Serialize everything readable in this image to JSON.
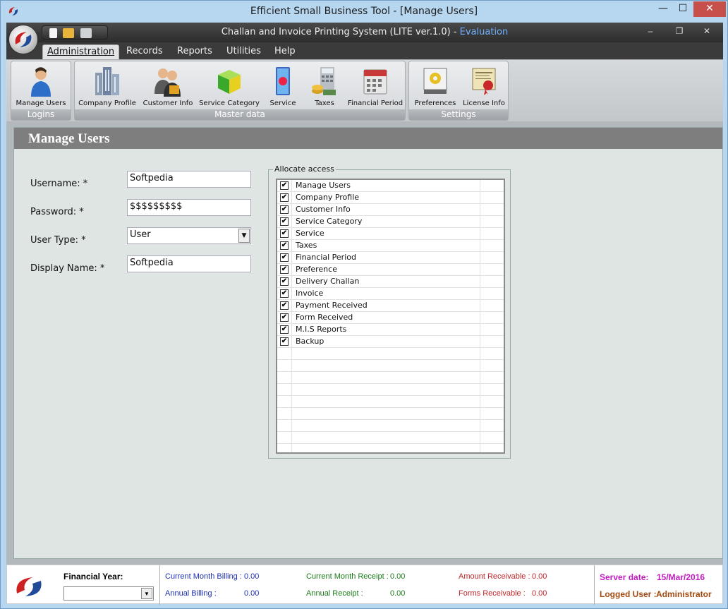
{
  "window": {
    "title": "Efficient Small Business Tool - [Manage Users]",
    "min": "—",
    "max": "☐",
    "close": "✕"
  },
  "app": {
    "title": "Challan and Invoice Printing System (LITE ver.1.0) - ",
    "edition": "Evaluation",
    "min": "–",
    "restore": "❐",
    "close": "✕"
  },
  "menu": [
    "Administration",
    "Records",
    "Reports",
    "Utilities",
    "Help"
  ],
  "ribbon": {
    "groups": [
      {
        "label": "Logins",
        "buttons": [
          "Manage Users"
        ]
      },
      {
        "label": "Master data",
        "buttons": [
          "Company Profile",
          "Customer Info",
          "Service Category",
          "Service",
          "Taxes",
          "Financial Period"
        ]
      },
      {
        "label": "Settings",
        "buttons": [
          "Preferences",
          "License Info"
        ]
      }
    ]
  },
  "form": {
    "title": "Manage Users",
    "username_label": "Username: *",
    "username_value": "Softpedia",
    "password_label": "Password: *",
    "password_value": "$$$$$$$$$",
    "usertype_label": "User Type: *",
    "usertype_value": "User",
    "displayname_label": "Display Name: *",
    "displayname_value": "Softpedia"
  },
  "access": {
    "legend": "Allocate access",
    "items": [
      "Manage Users",
      "Company Profile",
      "Customer Info",
      "Service Category",
      "Service",
      "Taxes",
      "Financial Period",
      "Preference",
      "Delivery Challan",
      "Invoice",
      "Payment Received",
      "Form Received",
      "M.I.S Reports",
      "Backup"
    ],
    "checked": [
      true,
      true,
      true,
      true,
      true,
      true,
      true,
      true,
      true,
      true,
      true,
      true,
      true,
      true
    ],
    "check_glyph": "✔"
  },
  "status": {
    "financial_year_label": "Financial Year:",
    "financial_year_value": "",
    "current_month_billing_label": "Current Month Billing :",
    "current_month_billing_value": "0.00",
    "annual_billing_label": "Annual Billing :",
    "annual_billing_value": "0.00",
    "current_month_receipt_label": "Current Month Receipt :",
    "current_month_receipt_value": "0.00",
    "annual_receipt_label": "Annual Receipt :",
    "annual_receipt_value": "0.00",
    "amount_receivable_label": "Amount Receivable :",
    "amount_receivable_value": "0.00",
    "forms_receivable_label": "Forms Receivable :",
    "forms_receivable_value": "0.00",
    "server_date_label": "Server date:",
    "server_date_value": "15/Mar/2016",
    "logged_user_label": "Logged User :",
    "logged_user_value": "Administrator"
  },
  "colors": {
    "billing": "#1e2fb0",
    "receipt": "#1b7a1b",
    "receivable": "#c0262a",
    "server_date": "#c21bc2",
    "logged_user": "#a24a10",
    "evaluation": "#6fb0ff"
  }
}
